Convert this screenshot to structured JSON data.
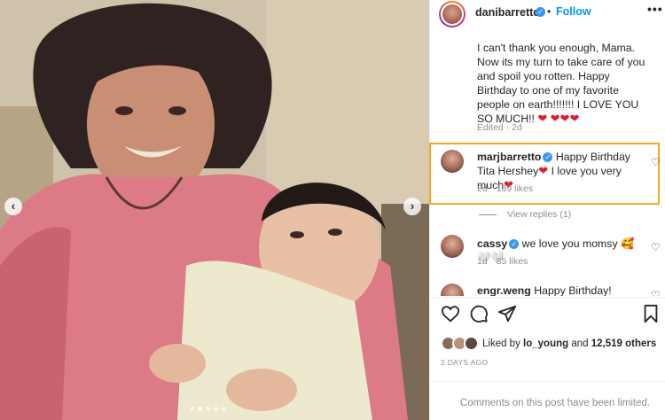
{
  "post": {
    "username": "danibarretto",
    "separator": "•",
    "follow_label": "Follow",
    "more_icon": "more-horizontal-icon",
    "caption_text": "I can't thank you enough, Mama. Now its my turn to take care of you and spoil you rotten. Happy Birthday to one of my favorite people on earth!!!!!!! I LOVE YOU SO MUCH!! ",
    "caption_hearts_1": "❤",
    "caption_hearts_2": "❤❤❤",
    "caption_meta": "Edited · 2d"
  },
  "comments": [
    {
      "username": "marjbarretto",
      "text": " Happy Birthday Tita Hershey",
      "heart1": "❤",
      "text2": " I love you very much",
      "heart2": "❤",
      "time": "2d",
      "likes": "139 likes",
      "view_replies": "View replies (1)",
      "highlighted": true
    },
    {
      "username": "cassy",
      "text": " we love you momsy ",
      "emoji": "🥰🤍🤍",
      "time": "1d",
      "likes": "85 likes"
    },
    {
      "username": "engr.weng",
      "text": " Happy Birthday!"
    }
  ],
  "likes": {
    "prefix": "Liked by ",
    "user": "lo_young",
    "middle": " and ",
    "count": "12,519 others"
  },
  "date": "2 DAYS AGO",
  "comments_limited": "Comments on this post have been limited.",
  "photo": {
    "dots_count": 5,
    "active_dot": 1,
    "prev_icon": "‹",
    "next_icon": "›"
  },
  "colors": {
    "accent": "#0095f6",
    "verified": "#3897f0",
    "heart": "#d62031",
    "highlight_border": "#f5a623",
    "shirt_pink": "#dc7a86"
  }
}
